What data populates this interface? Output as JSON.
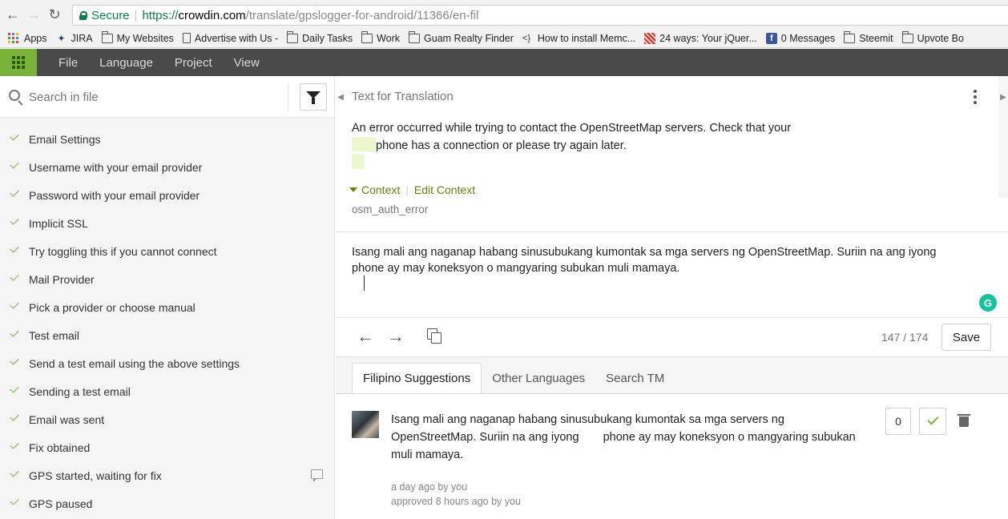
{
  "browser": {
    "secure_label": "Secure",
    "url_scheme": "https://",
    "url_host": "crowdin.com",
    "url_path": "/translate/gpslogger-for-android/11366/en-fil"
  },
  "bookmarks": [
    {
      "label": "Apps",
      "icon": "apps-grid-icon"
    },
    {
      "label": "JIRA",
      "icon": "jira-icon"
    },
    {
      "label": "My Websites",
      "icon": "folder-icon"
    },
    {
      "label": "Advertise with Us -",
      "icon": "page-icon"
    },
    {
      "label": "Daily Tasks",
      "icon": "folder-icon"
    },
    {
      "label": "Work",
      "icon": "folder-icon"
    },
    {
      "label": "Guam Realty Finder",
      "icon": "folder-icon"
    },
    {
      "label": "How to install Memc...",
      "icon": "code-icon"
    },
    {
      "label": "24 ways: Your jQuer...",
      "icon": "site-icon"
    },
    {
      "label": "0 Messages",
      "icon": "facebook-icon"
    },
    {
      "label": "Steemit",
      "icon": "folder-icon"
    },
    {
      "label": "Upvote Bo",
      "icon": "folder-icon"
    }
  ],
  "menu": {
    "file": "File",
    "language": "Language",
    "project": "Project",
    "view": "View"
  },
  "search": {
    "placeholder": "Search in file"
  },
  "strings": [
    {
      "label": "Email Settings",
      "comment": false
    },
    {
      "label": "Username with your email provider",
      "comment": false
    },
    {
      "label": "Password with your email provider",
      "comment": false
    },
    {
      "label": "Implicit SSL",
      "comment": false
    },
    {
      "label": "Try toggling this if you cannot connect",
      "comment": false
    },
    {
      "label": "Mail Provider",
      "comment": false
    },
    {
      "label": "Pick a provider or choose manual",
      "comment": false
    },
    {
      "label": "Test email",
      "comment": false
    },
    {
      "label": "Send a test email using the above settings",
      "comment": false
    },
    {
      "label": "Sending a test email",
      "comment": false
    },
    {
      "label": "Email was sent",
      "comment": false
    },
    {
      "label": "Fix obtained",
      "comment": false
    },
    {
      "label": "GPS started, waiting for fix",
      "comment": true
    },
    {
      "label": "GPS paused",
      "comment": false
    }
  ],
  "editor": {
    "panel_title": "Text for Translation",
    "source_line1": "An error occurred while trying to contact the OpenStreetMap servers. Check that your",
    "source_line2": "phone has a connection or please try again later.",
    "context_label": "Context",
    "edit_context_label": "Edit Context",
    "context_key": "osm_auth_error",
    "translation_line1": "Isang mali ang naganap habang sinusubukang kumontak sa mga servers ng OpenStreetMap. Suriin na ang iyong",
    "translation_line2": "phone ay may koneksyon o mangyaring subukan muli mamaya.",
    "char_count": "147 / 174",
    "save_label": "Save",
    "grammarly_letter": "G"
  },
  "suggestions": {
    "tabs": [
      "Filipino Suggestions",
      "Other Languages",
      "Search TM"
    ],
    "item": {
      "line1": "Isang mali ang naganap habang sinusubukang kumontak sa mga servers ng",
      "line2_a": "OpenStreetMap. Suriin na ang iyong",
      "line2_b": "phone ay may koneksyon o mangyaring subukan",
      "line3": "muli mamaya.",
      "votes": "0",
      "meta_added": "a day ago by you",
      "meta_approved": "approved 8 hours ago by you"
    }
  },
  "colors": {
    "accent_green": "#7ab339",
    "toolbar_bg": "#4a4a4a",
    "highlight": "#edf7cf",
    "context_link": "#6d7e12"
  }
}
